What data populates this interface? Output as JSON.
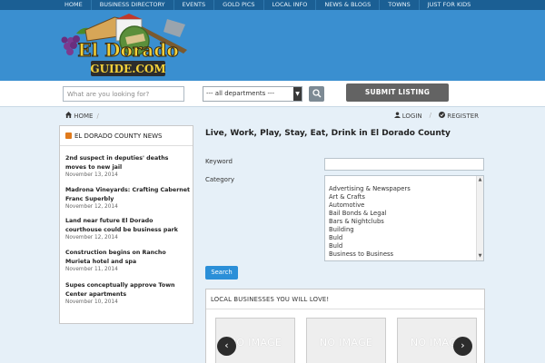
{
  "topnav": [
    "HOME",
    "BUSINESS DIRECTORY",
    "EVENTS",
    "GOLD PICS",
    "LOCAL INFO",
    "NEWS & BLOGS",
    "TOWNS",
    "JUST FOR KIDS"
  ],
  "logo": {
    "line1": "El Dorado",
    "line2": "GUIDE.COM"
  },
  "search": {
    "placeholder": "What are you looking for?",
    "department": "--- all departments ---",
    "submit_listing": "SUBMIT LISTING"
  },
  "breadcrumb": {
    "home": "HOME"
  },
  "auth": {
    "login": "LOGIN",
    "register": "REGISTER"
  },
  "news": {
    "title": "EL DORADO COUNTY NEWS",
    "items": [
      {
        "title": "2nd suspect in deputies' deaths moves to new jail",
        "date": "November 13, 2014"
      },
      {
        "title": "Madrona Vineyards: Crafting Cabernet Franc Superbly",
        "date": "November 12, 2014"
      },
      {
        "title": "Land near future El Dorado courthouse could be business park",
        "date": "November 12, 2014"
      },
      {
        "title": "Construction begins on Rancho Murieta hotel and spa",
        "date": "November 11, 2014"
      },
      {
        "title": "Supes conceptually approve Town Center apartments",
        "date": "November 10, 2014"
      }
    ]
  },
  "main": {
    "title": "Live, Work, Play, Stay, Eat, Drink in El Dorado County",
    "keyword_label": "Keyword",
    "category_label": "Category",
    "categories": [
      "Advertising & Newspapers",
      "Art & Crafts",
      "Automotive",
      "Bail Bonds & Legal",
      "Bars & Nightclubs",
      "Building",
      "Buld",
      "Buld",
      "Business to Business"
    ],
    "search_button": "Search"
  },
  "local": {
    "title": "LOCAL BUSINESSES YOU WILL LOVE!",
    "no_image": "NO IMAGE"
  },
  "colors": {
    "nav": "#1b5f94",
    "banner": "#3a8fd0",
    "accent": "#2b8fd8"
  }
}
